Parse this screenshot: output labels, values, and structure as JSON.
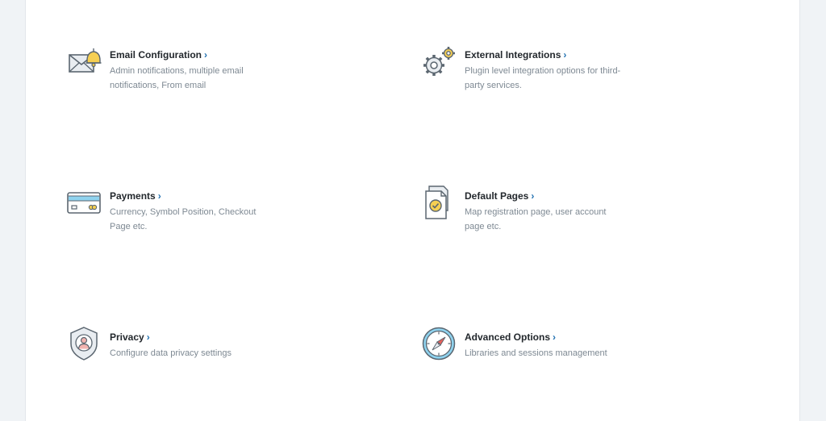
{
  "colors": {
    "page_bg": "#f0f3f6",
    "panel_bg": "#ffffff",
    "title": "#23282d",
    "description": "#7e8993",
    "chevron": "#2271b1"
  },
  "cards": [
    {
      "title": "Email Configuration",
      "chevron": "›",
      "desc_line1": "Admin notifications, multiple email",
      "desc_line2": "notifications, From email",
      "icon": "email-bell-icon"
    },
    {
      "title": "External Integrations",
      "chevron": "›",
      "desc_line1": "Plugin level integration options for third-",
      "desc_line2": "party services.",
      "icon": "gears-icon"
    },
    {
      "title": "Payments",
      "chevron": "›",
      "desc_line1": "Currency, Symbol Position, Checkout",
      "desc_line2": "Page etc.",
      "icon": "credit-card-icon"
    },
    {
      "title": "Default Pages",
      "chevron": "›",
      "desc_line1": "Map registration page, user account",
      "desc_line2": "page etc.",
      "icon": "documents-check-icon"
    },
    {
      "title": "Privacy",
      "chevron": "›",
      "desc_line1": "Configure data privacy settings",
      "desc_line2": "",
      "icon": "privacy-shield-icon"
    },
    {
      "title": "Advanced Options",
      "chevron": "›",
      "desc_line1": "Libraries and sessions management",
      "desc_line2": "",
      "icon": "compass-icon"
    }
  ]
}
